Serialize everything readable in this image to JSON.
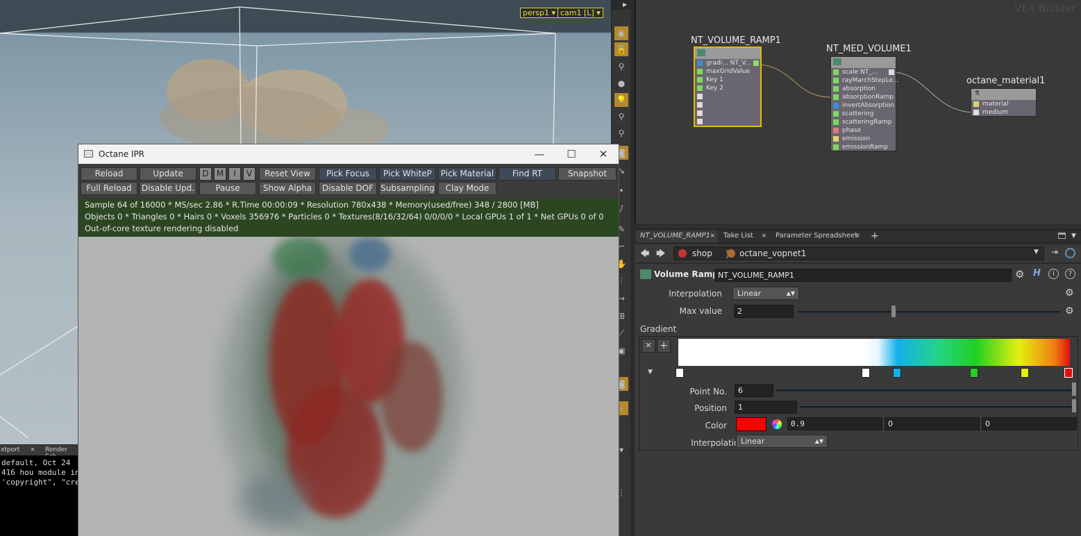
{
  "viewport": {
    "camera": "persp1",
    "cam": "cam1 [L]"
  },
  "console": {
    "tabs": [
      "xtport",
      "Render Sch"
    ],
    "lines": [
      "default, Oct 24",
      "416 hou module in",
      "'copyright\", \"cre"
    ]
  },
  "ipr": {
    "title": "Octane IPR",
    "buttons_row1": [
      "Reload",
      "Update",
      "D",
      "M",
      "I",
      "V",
      "Reset View",
      "Pick Focus",
      "Pick WhiteP",
      "Pick Material",
      "Find RT",
      "Snapshot"
    ],
    "buttons_row2": [
      "Full Reload",
      "Disable Upd.",
      "Pause",
      "Show Alpha",
      "Disable DOF",
      "Subsampling",
      "Clay Mode"
    ],
    "status": [
      "Sample 64 of 16000 * MS/sec 2.86 * R.Time 00:00:09 * Resolution 780x438 * Memory(used/free) 348 / 2800 [MB]",
      "Objects 0 * Triangles 0 * Hairs 0 * Voxels 356976 * Particles 0 * Textures(8/16/32/64) 0/0/0/0 * Local GPUs 1 of 1 * Net GPUs 0 of 0",
      "Out-of-core texture rendering disabled"
    ]
  },
  "network": {
    "watermark": "VEX Builder",
    "nodes": [
      {
        "title": "NT_VOLUME_RAMP1",
        "ports": [
          "gradi... NT_V...",
          "maxGridValue",
          "Key 1",
          "Key 2",
          "",
          "",
          "",
          ""
        ]
      },
      {
        "title": "NT_MED_VOLUME1",
        "ports": [
          "scale     NT_...",
          "rayMarchStepLe...",
          "absorption",
          "absorptionRamp",
          "invertAbsorption",
          "scattering",
          "scatteringRamp",
          "phase",
          "emission",
          "emissionRamp"
        ]
      },
      {
        "title": "octane_material1",
        "ports": [
          "material",
          "medium"
        ]
      }
    ]
  },
  "tabs": [
    "NT_VOLUME_RAMP1",
    "Take List",
    "Parameter Spreadsheet"
  ],
  "path": {
    "shop": "shop",
    "vopnet": "octane_vopnet1"
  },
  "params": {
    "node_type": "Volume Ramp",
    "node_name": "NT_VOLUME_RAMP1",
    "interpolation_label": "Interpolation",
    "interpolation": "Linear",
    "max_label": "Max value",
    "max": "2",
    "gradient_label": "Gradient",
    "point_label": "Point No.",
    "point": "6",
    "position_label": "Position",
    "position": "1",
    "color_label": "Color",
    "color_r": "0.9",
    "color_g": "0",
    "color_b": "0",
    "interp2_label": "Interpolation",
    "interp2": "Linear"
  },
  "colors": {
    "selected_node": "#e8b800",
    "status_bg": "#2c4622",
    "color_swatch": "#ff0000"
  }
}
